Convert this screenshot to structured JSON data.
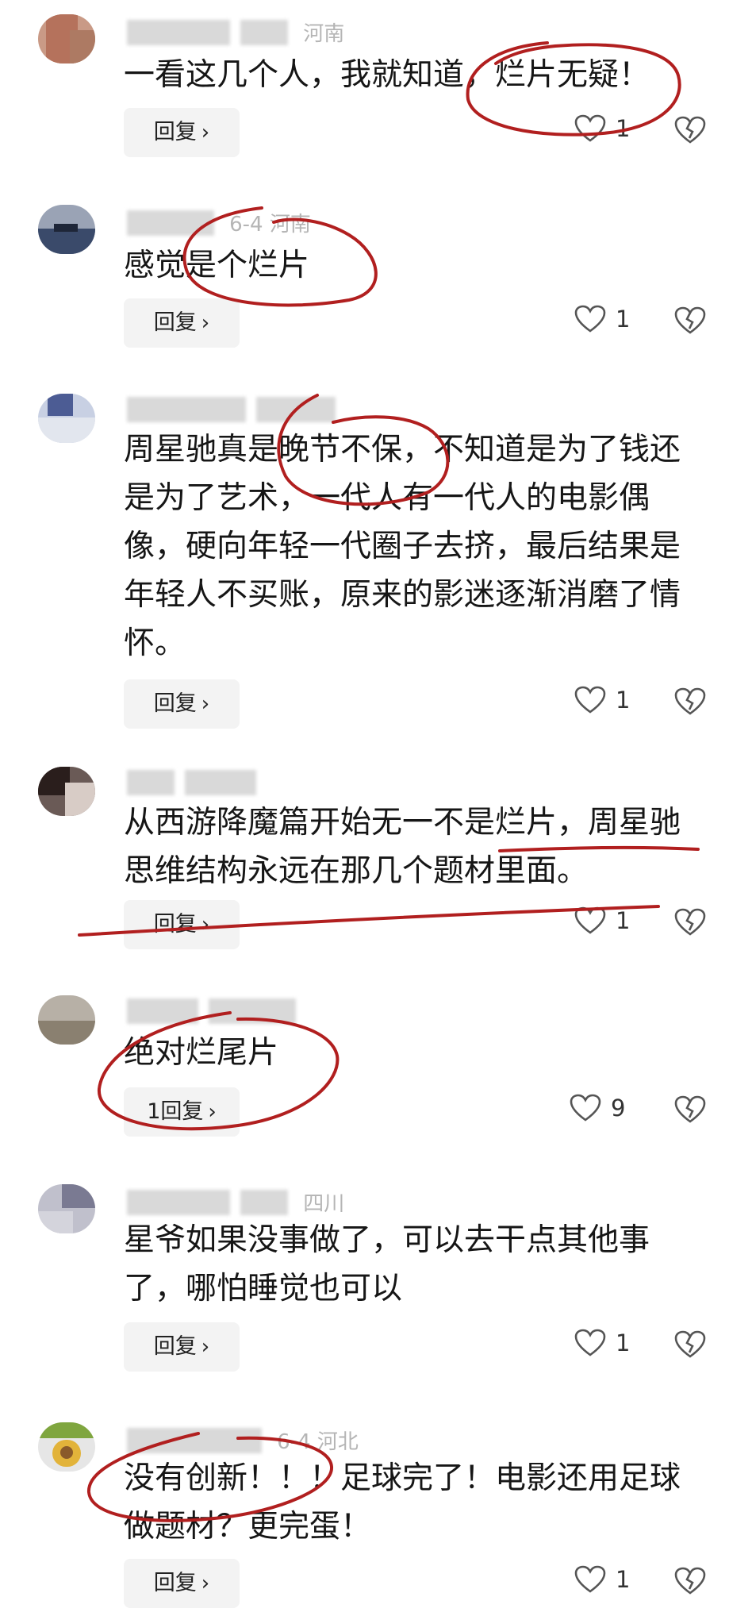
{
  "comments": [
    {
      "location": "河南",
      "text": "一看这几个人，我就知道，烂片无疑！",
      "reply_label": "回复",
      "likes": "1"
    },
    {
      "location": "6-4  河南",
      "text": "感觉是个烂片",
      "reply_label": "回复",
      "likes": "1"
    },
    {
      "location": "",
      "text": "周星驰真是晚节不保，不知道是为了钱还是为了艺术，一代人有一代人的电影偶像，硬向年轻一代圈子去挤，最后结果是年轻人不买账，原来的影迷逐渐消磨了情怀。",
      "reply_label": "回复",
      "likes": "1"
    },
    {
      "location": "",
      "text": "从西游降魔篇开始无一不是烂片，周星驰思维结构永远在那几个题材里面。",
      "reply_label": "回复",
      "likes": "1"
    },
    {
      "location": "",
      "text": "绝对烂尾片",
      "reply_label": "1回复",
      "likes": "9"
    },
    {
      "location": "四川",
      "text": "星爷如果没事做了，可以去干点其他事了，哪怕睡觉也可以",
      "reply_label": "回复",
      "likes": "1"
    },
    {
      "location": "6-4  河北",
      "text": "没有创新！！！足球完了！电影还用足球做题材？更完蛋！",
      "reply_label": "回复",
      "likes": "1"
    }
  ],
  "colors": {
    "annotation": "#b11f1f",
    "avatar_1": "#b5725c",
    "avatar_2": "#3a4a6a",
    "avatar_3": "#4c5c94",
    "avatar_4": "#3a2a26",
    "avatar_5": "#8a8070",
    "avatar_6": "#7a7a92",
    "avatar_7": "#7fa63f"
  },
  "icons": {
    "like": "heart-outline-icon",
    "dislike": "broken-heart-icon",
    "reply_arrow": "chevron-right-icon"
  }
}
